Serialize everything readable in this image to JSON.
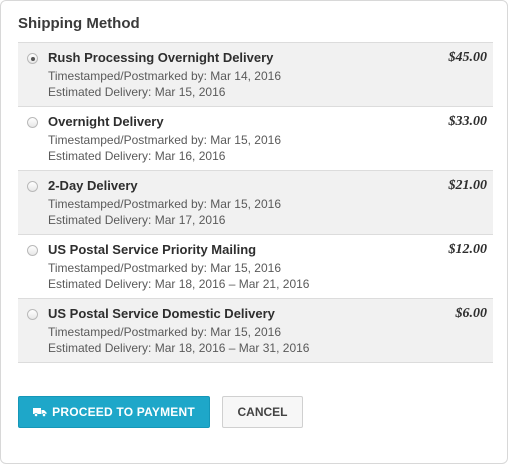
{
  "title": "Shipping Method",
  "options": [
    {
      "name": "Rush Processing Overnight Delivery",
      "timestamped": "Timestamped/Postmarked by: Mar 14, 2016",
      "estimated": "Estimated Delivery: Mar 15, 2016",
      "price": "$45.00",
      "selected": true
    },
    {
      "name": "Overnight Delivery",
      "timestamped": "Timestamped/Postmarked by: Mar 15, 2016",
      "estimated": "Estimated Delivery: Mar 16, 2016",
      "price": "$33.00",
      "selected": false
    },
    {
      "name": "2-Day Delivery",
      "timestamped": "Timestamped/Postmarked by: Mar 15, 2016",
      "estimated": "Estimated Delivery: Mar 17, 2016",
      "price": "$21.00",
      "selected": false
    },
    {
      "name": "US Postal Service Priority Mailing",
      "timestamped": "Timestamped/Postmarked by: Mar 15, 2016",
      "estimated": "Estimated Delivery: Mar 18, 2016 – Mar 21, 2016",
      "price": "$12.00",
      "selected": false
    },
    {
      "name": "US Postal Service Domestic Delivery",
      "timestamped": "Timestamped/Postmarked by: Mar 15, 2016",
      "estimated": "Estimated Delivery: Mar 18, 2016 – Mar 31, 2016",
      "price": "$6.00",
      "selected": false
    }
  ],
  "buttons": {
    "proceed_label": "PROCEED TO PAYMENT",
    "proceed_icon": "truck-icon",
    "cancel_label": "CANCEL"
  },
  "colors": {
    "accent": "#1ea7c9",
    "row_shade": "#f1f1f1"
  }
}
